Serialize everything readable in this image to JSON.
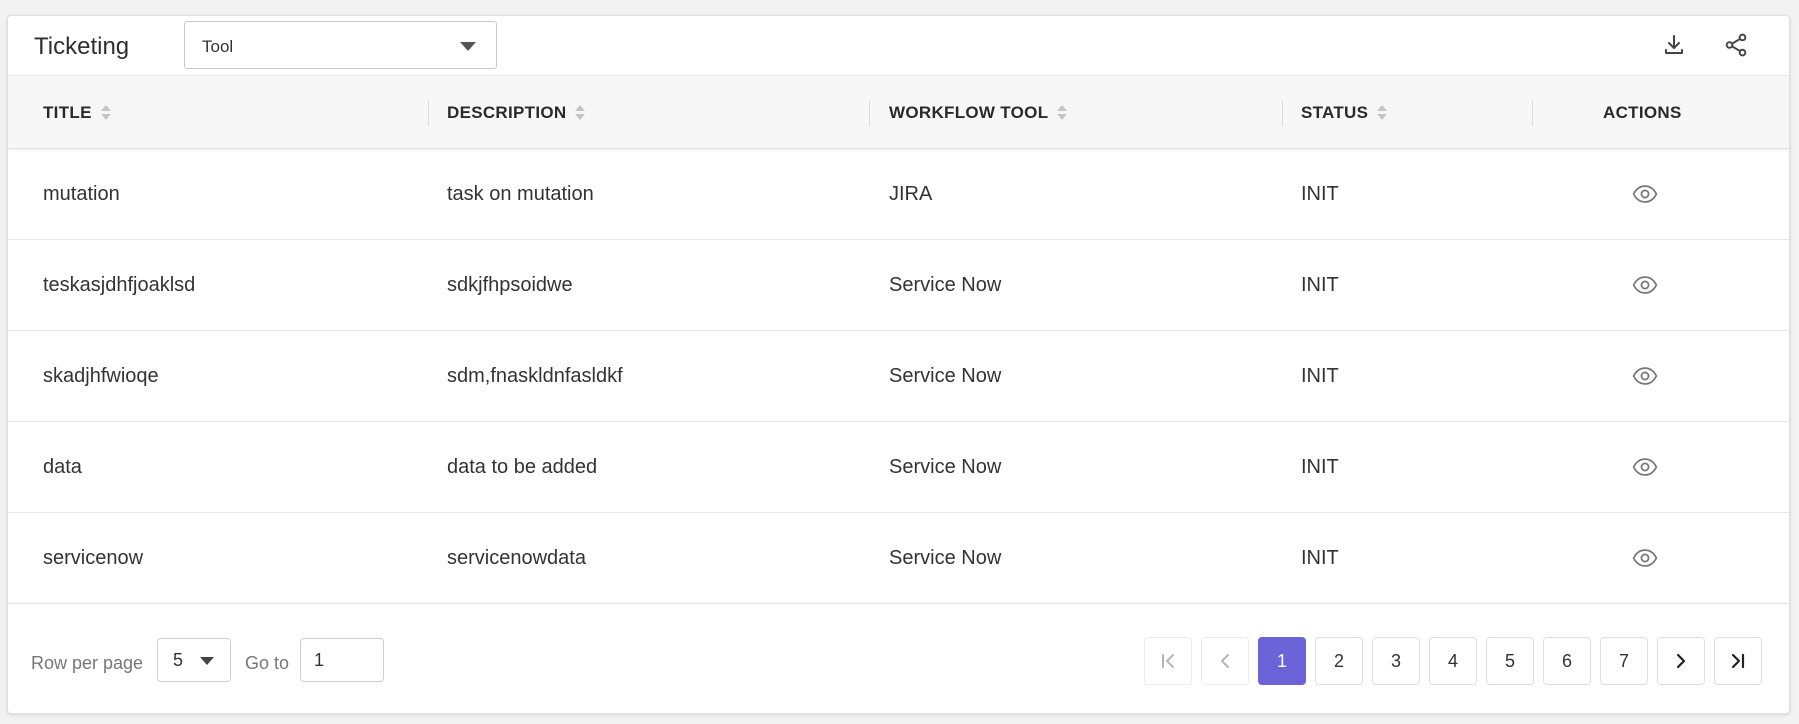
{
  "header": {
    "title": "Ticketing",
    "tool_select": {
      "value": "Tool"
    }
  },
  "table": {
    "columns": [
      {
        "label": "TITLE",
        "sortable": true
      },
      {
        "label": "DESCRIPTION",
        "sortable": true
      },
      {
        "label": "WORKFLOW TOOL",
        "sortable": true
      },
      {
        "label": "STATUS",
        "sortable": true
      },
      {
        "label": "ACTIONS",
        "sortable": false
      }
    ],
    "rows": [
      {
        "title": "mutation",
        "description": "task on mutation",
        "workflow_tool": "JIRA",
        "status": "INIT"
      },
      {
        "title": "teskasjdhfjoaklsd",
        "description": "sdkjfhpsoidwe",
        "workflow_tool": "Service Now",
        "status": "INIT"
      },
      {
        "title": "skadjhfwioqe",
        "description": "sdm,fnaskldnfasldkf",
        "workflow_tool": "Service Now",
        "status": "INIT"
      },
      {
        "title": "data",
        "description": "data to be added",
        "workflow_tool": "Service Now",
        "status": "INIT"
      },
      {
        "title": "servicenow",
        "description": "servicenowdata",
        "workflow_tool": "Service Now",
        "status": "INIT"
      }
    ]
  },
  "pagination": {
    "rows_per_page_label": "Row per page",
    "rows_per_page_value": "5",
    "goto_label": "Go to",
    "goto_value": "1",
    "pages": [
      "1",
      "2",
      "3",
      "4",
      "5",
      "6",
      "7"
    ],
    "current_page": "1"
  },
  "colors": {
    "accent": "#6b63d8",
    "header_bg": "#f7f7f7"
  },
  "icons": {
    "download": "download-icon",
    "share": "share-icon",
    "view": "eye-icon",
    "first": "first-page-icon",
    "prev": "chevron-left-icon",
    "next": "chevron-right-icon",
    "last": "last-page-icon"
  }
}
